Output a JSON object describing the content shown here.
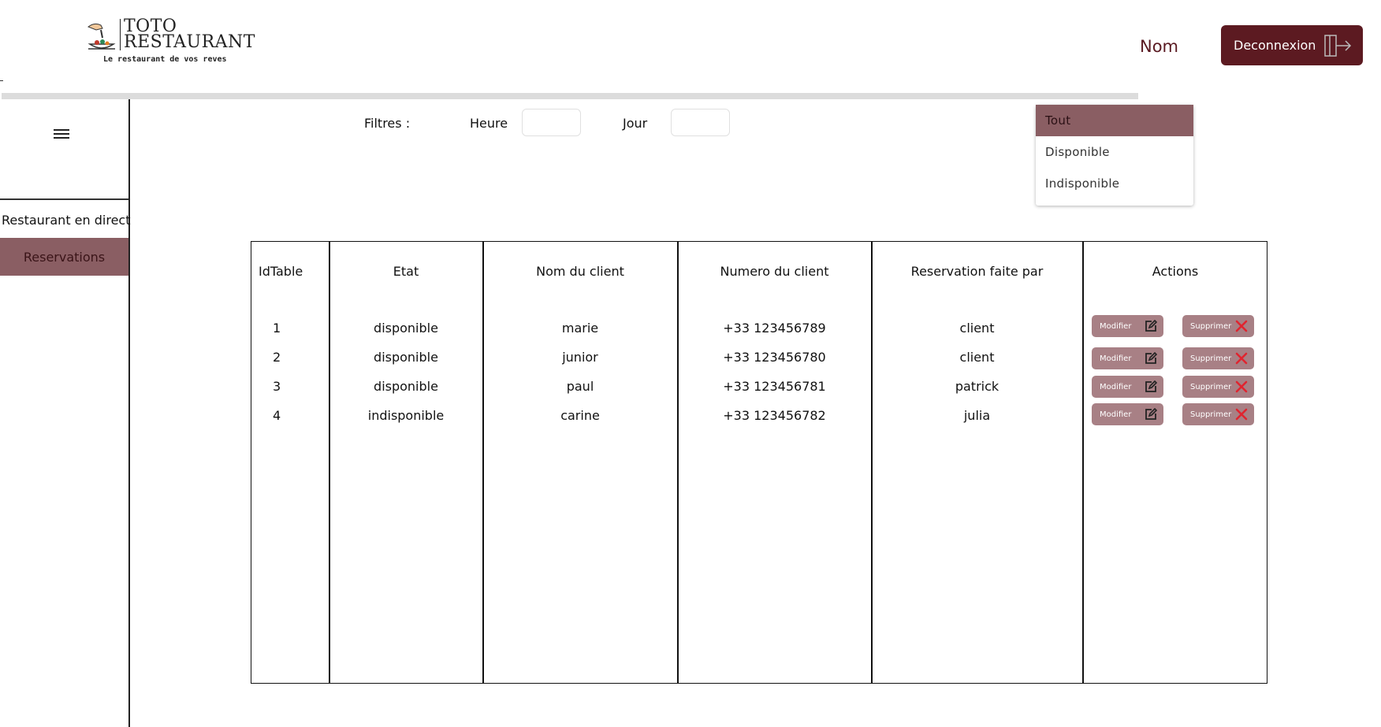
{
  "header": {
    "logo_title_line1": "TOTO",
    "logo_title_line2": "RESTAURANT",
    "logo_tagline": "Le restaurant de vos reves",
    "user_name": "Nom",
    "logout_label": "Deconnexion"
  },
  "sidebar": {
    "items": [
      {
        "label": "Restaurant en direct",
        "active": false
      },
      {
        "label": "Reservations",
        "active": true
      }
    ]
  },
  "filters": {
    "label": "Filtres :",
    "heure_label": "Heure",
    "heure_value": "",
    "jour_label": "Jour",
    "jour_value": "",
    "state_options": [
      "Tout",
      "Disponible",
      "Indisponible"
    ],
    "state_selected": "Tout"
  },
  "table": {
    "headers": [
      "IdTable",
      "Etat",
      "Nom du client",
      "Numero du client",
      "Reservation faite par",
      "Actions"
    ],
    "rows": [
      {
        "id": "1",
        "etat": "disponible",
        "nom": "marie",
        "numero": "+33 123456789",
        "par": "client"
      },
      {
        "id": "2",
        "etat": "disponible",
        "nom": "junior",
        "numero": "+33 123456780",
        "par": "client"
      },
      {
        "id": "3",
        "etat": "disponible",
        "nom": "paul",
        "numero": "+33 123456781",
        "par": "patrick"
      },
      {
        "id": "4",
        "etat": "indisponible",
        "nom": "carine",
        "numero": "+33 123456782",
        "par": "julia"
      }
    ],
    "modify_label": "Modifier",
    "delete_label": "Supprimer"
  },
  "colors": {
    "brand_dark": "#5c1a21",
    "accent_muted": "#8a5e63",
    "action_button": "#a88085",
    "delete_icon": "#e0242f"
  },
  "icons": {
    "logout": "logout-icon",
    "menu": "hamburger-icon",
    "edit": "edit-icon",
    "delete": "close-icon"
  }
}
